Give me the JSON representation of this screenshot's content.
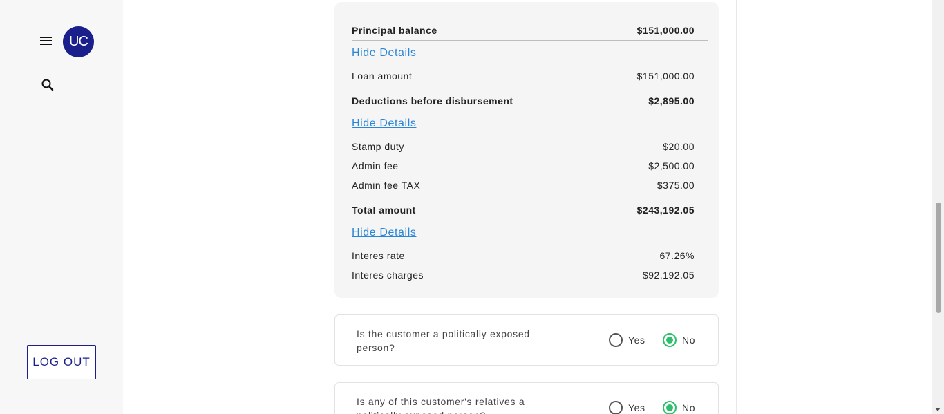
{
  "sidebar": {
    "avatar_initials": "UC",
    "menu_icon": "hamburger-menu-icon",
    "search_icon": "search-icon",
    "logout_label": "LOG OUT"
  },
  "summary": {
    "principal": {
      "label": "Principal balance",
      "value": "$151,000.00",
      "toggle": "Hide Details",
      "items": [
        {
          "label": "Loan amount",
          "value": "$151,000.00"
        }
      ]
    },
    "deductions": {
      "label": "Deductions before disbursement",
      "value": "$2,895.00",
      "toggle": "Hide Details",
      "items": [
        {
          "label": "Stamp duty",
          "value": "$20.00"
        },
        {
          "label": "Admin fee",
          "value": "$2,500.00"
        },
        {
          "label": "Admin fee TAX",
          "value": "$375.00"
        }
      ]
    },
    "total": {
      "label": "Total amount",
      "value": "$243,192.05",
      "toggle": "Hide Details",
      "items": [
        {
          "label": "Interes rate",
          "value": "67.26%"
        },
        {
          "label": "Interes charges",
          "value": "$92,192.05"
        }
      ]
    }
  },
  "questions": [
    {
      "text": "Is the customer a politically exposed person?",
      "yes_label": "Yes",
      "no_label": "No",
      "selected": "No"
    },
    {
      "text": "Is any of this customer's relatives a politically exposed person?",
      "yes_label": "Yes",
      "no_label": "No",
      "selected": "No"
    }
  ],
  "colors": {
    "brand": "#1a1f8c",
    "link": "#2a86d6",
    "radio_selected": "#2dbf6c"
  }
}
